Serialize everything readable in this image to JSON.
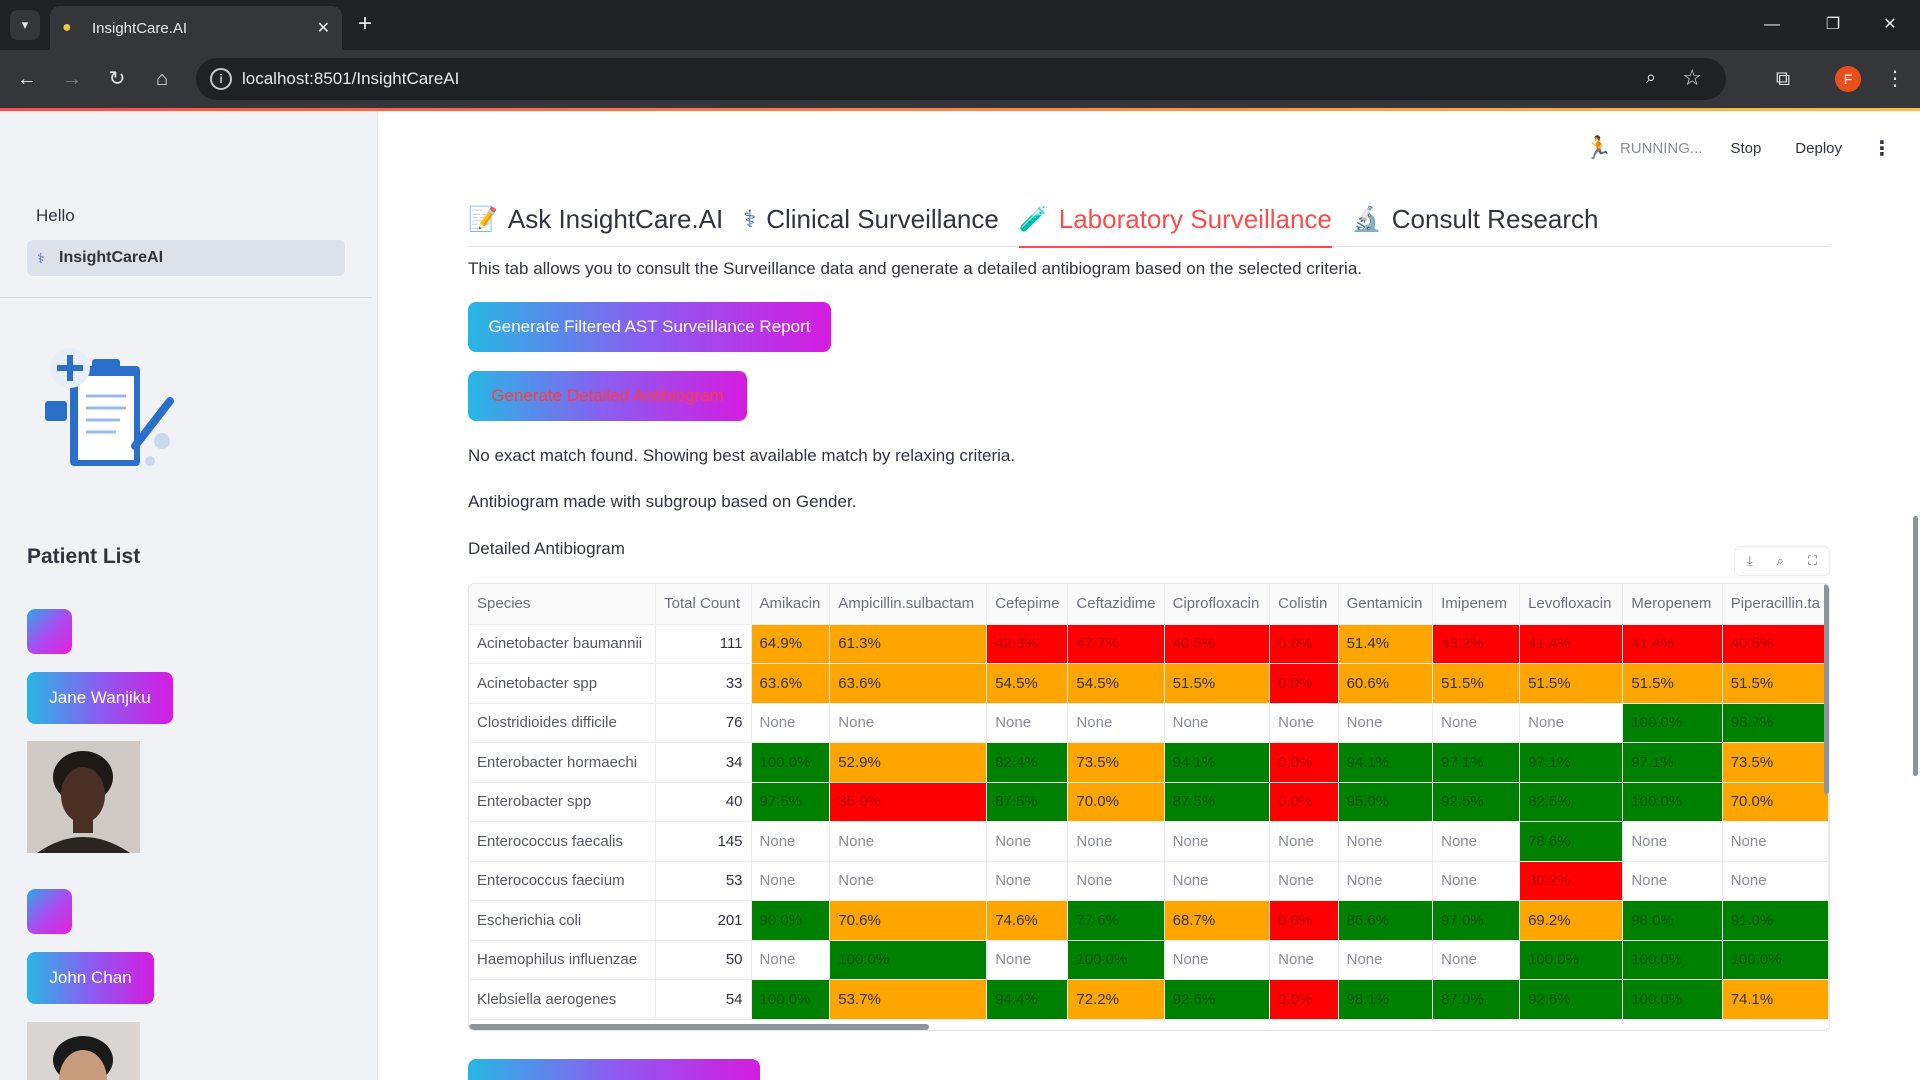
{
  "browser": {
    "tab_title": "InsightCare.AI",
    "url": "localhost:8501/InsightCareAI",
    "profile_initial": "F"
  },
  "header": {
    "status": "RUNNING...",
    "stop": "Stop",
    "deploy": "Deploy"
  },
  "sidebar": {
    "hello": "Hello",
    "nav_item": "InsightCareAI",
    "patient_list_title": "Patient List",
    "patients": [
      "Jane Wanjiku",
      "John Chan"
    ]
  },
  "tabs": [
    {
      "label": "Ask InsightCare.AI",
      "icon": "memo-icon"
    },
    {
      "label": "Clinical Surveillance",
      "icon": "stethoscope-icon"
    },
    {
      "label": "Laboratory Surveillance",
      "icon": "test-tube-icon"
    },
    {
      "label": "Consult Research",
      "icon": "microscope-icon"
    }
  ],
  "main": {
    "intro": "This tab allows you to consult the Surveillance data and generate a detailed antibiogram based on the selected criteria.",
    "btn_report": "Generate Filtered AST Surveillance Report",
    "btn_antibiogram": "Generate Detailed Antibiogram",
    "no_match": "No exact match found. Showing best available match by relaxing criteria.",
    "subgroup": "Antibiogram made with subgroup based on Gender.",
    "detailed": "Detailed Antibiogram"
  },
  "colors": {
    "red": "#ff0000",
    "orange": "#ffa500",
    "green": "#008000",
    "accent": "#ff4b4b"
  },
  "table": {
    "columns": [
      "Species",
      "Total Count",
      "Amikacin",
      "Ampicillin.sulbactam",
      "Cefepime",
      "Ceftazidime",
      "Ciprofloxacin",
      "Colistin",
      "Gentamicin",
      "Imipenem",
      "Levofloxacin",
      "Meropenem",
      "Piperacillin.ta"
    ],
    "rows": [
      {
        "species": "Acinetobacter baumannii",
        "count": "111",
        "cells": [
          [
            "64.9%",
            "orange"
          ],
          [
            "61.3%",
            "orange"
          ],
          [
            "42.3%",
            "red"
          ],
          [
            "47.7%",
            "red"
          ],
          [
            "40.5%",
            "red"
          ],
          [
            "0.0%",
            "red"
          ],
          [
            "51.4%",
            "orange"
          ],
          [
            "43.2%",
            "red"
          ],
          [
            "41.4%",
            "red"
          ],
          [
            "41.4%",
            "red"
          ],
          [
            "40.5%",
            "red"
          ]
        ]
      },
      {
        "species": "Acinetobacter spp",
        "count": "33",
        "cells": [
          [
            "63.6%",
            "orange"
          ],
          [
            "63.6%",
            "orange"
          ],
          [
            "54.5%",
            "orange"
          ],
          [
            "54.5%",
            "orange"
          ],
          [
            "51.5%",
            "orange"
          ],
          [
            "0.0%",
            "red"
          ],
          [
            "60.6%",
            "orange"
          ],
          [
            "51.5%",
            "orange"
          ],
          [
            "51.5%",
            "orange"
          ],
          [
            "51.5%",
            "orange"
          ],
          [
            "51.5%",
            "orange"
          ]
        ]
      },
      {
        "species": "Clostridioides difficile",
        "count": "76",
        "cells": [
          [
            "None",
            "none"
          ],
          [
            "None",
            "none"
          ],
          [
            "None",
            "none"
          ],
          [
            "None",
            "none"
          ],
          [
            "None",
            "none"
          ],
          [
            "None",
            "none"
          ],
          [
            "None",
            "none"
          ],
          [
            "None",
            "none"
          ],
          [
            "None",
            "none"
          ],
          [
            "100.0%",
            "green"
          ],
          [
            "98.7%",
            "green"
          ]
        ]
      },
      {
        "species": "Enterobacter hormaechi",
        "count": "34",
        "cells": [
          [
            "100.0%",
            "green"
          ],
          [
            "52.9%",
            "orange"
          ],
          [
            "82.4%",
            "green"
          ],
          [
            "73.5%",
            "orange"
          ],
          [
            "94.1%",
            "green"
          ],
          [
            "0.0%",
            "red"
          ],
          [
            "94.1%",
            "green"
          ],
          [
            "97.1%",
            "green"
          ],
          [
            "97.1%",
            "green"
          ],
          [
            "97.1%",
            "green"
          ],
          [
            "73.5%",
            "orange"
          ]
        ]
      },
      {
        "species": "Enterobacter spp",
        "count": "40",
        "cells": [
          [
            "97.5%",
            "green"
          ],
          [
            "35.0%",
            "red"
          ],
          [
            "87.5%",
            "green"
          ],
          [
            "70.0%",
            "orange"
          ],
          [
            "87.5%",
            "green"
          ],
          [
            "0.0%",
            "red"
          ],
          [
            "95.0%",
            "green"
          ],
          [
            "92.5%",
            "green"
          ],
          [
            "82.5%",
            "green"
          ],
          [
            "100.0%",
            "green"
          ],
          [
            "70.0%",
            "orange"
          ]
        ]
      },
      {
        "species": "Enterococcus faecalis",
        "count": "145",
        "cells": [
          [
            "None",
            "none"
          ],
          [
            "None",
            "none"
          ],
          [
            "None",
            "none"
          ],
          [
            "None",
            "none"
          ],
          [
            "None",
            "none"
          ],
          [
            "None",
            "none"
          ],
          [
            "None",
            "none"
          ],
          [
            "None",
            "none"
          ],
          [
            "78.6%",
            "green"
          ],
          [
            "None",
            "none"
          ],
          [
            "None",
            "none"
          ]
        ]
      },
      {
        "species": "Enterococcus faecium",
        "count": "53",
        "cells": [
          [
            "None",
            "none"
          ],
          [
            "None",
            "none"
          ],
          [
            "None",
            "none"
          ],
          [
            "None",
            "none"
          ],
          [
            "None",
            "none"
          ],
          [
            "None",
            "none"
          ],
          [
            "None",
            "none"
          ],
          [
            "None",
            "none"
          ],
          [
            "30.2%",
            "red"
          ],
          [
            "None",
            "none"
          ],
          [
            "None",
            "none"
          ]
        ]
      },
      {
        "species": "Escherichia coli",
        "count": "201",
        "cells": [
          [
            "90.0%",
            "green"
          ],
          [
            "70.6%",
            "orange"
          ],
          [
            "74.6%",
            "orange"
          ],
          [
            "77.6%",
            "green"
          ],
          [
            "68.7%",
            "orange"
          ],
          [
            "0.0%",
            "red"
          ],
          [
            "86.6%",
            "green"
          ],
          [
            "97.0%",
            "green"
          ],
          [
            "69.2%",
            "orange"
          ],
          [
            "98.0%",
            "green"
          ],
          [
            "91.0%",
            "green"
          ]
        ]
      },
      {
        "species": "Haemophilus influenzae",
        "count": "50",
        "cells": [
          [
            "None",
            "none"
          ],
          [
            "100.0%",
            "green"
          ],
          [
            "None",
            "none"
          ],
          [
            "100.0%",
            "green"
          ],
          [
            "None",
            "none"
          ],
          [
            "None",
            "none"
          ],
          [
            "None",
            "none"
          ],
          [
            "None",
            "none"
          ],
          [
            "100.0%",
            "green"
          ],
          [
            "100.0%",
            "green"
          ],
          [
            "100.0%",
            "green"
          ]
        ]
      },
      {
        "species": "Klebsiella aerogenes",
        "count": "54",
        "cells": [
          [
            "100.0%",
            "green"
          ],
          [
            "53.7%",
            "orange"
          ],
          [
            "94.4%",
            "green"
          ],
          [
            "72.2%",
            "orange"
          ],
          [
            "92.6%",
            "green"
          ],
          [
            "0.0%",
            "red"
          ],
          [
            "98.1%",
            "green"
          ],
          [
            "87.0%",
            "green"
          ],
          [
            "92.6%",
            "green"
          ],
          [
            "100.0%",
            "green"
          ],
          [
            "74.1%",
            "orange"
          ]
        ]
      }
    ]
  }
}
